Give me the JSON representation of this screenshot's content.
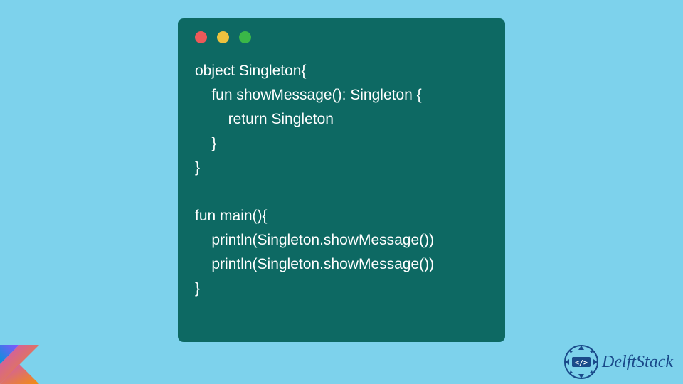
{
  "code": {
    "line1": "object Singleton{",
    "line2": "    fun showMessage(): Singleton {",
    "line3": "        return Singleton",
    "line4": "    }",
    "line5": "}",
    "line6": "",
    "line7": "fun main(){",
    "line8": "    println(Singleton.showMessage())",
    "line9": "    println(Singleton.showMessage())",
    "line10": "}"
  },
  "branding": {
    "name": "DelftStack"
  },
  "colors": {
    "background": "#7dd2ec",
    "window": "#0d6963",
    "text": "#ffffff"
  }
}
